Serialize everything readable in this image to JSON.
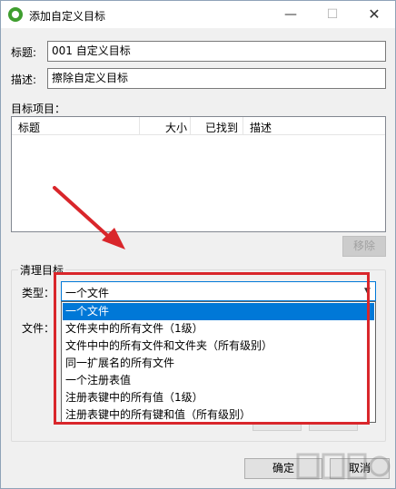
{
  "window": {
    "title": "添加自定义目标",
    "minimize": "—",
    "maximize": "☐",
    "close": "✕"
  },
  "form": {
    "title_label": "标题:",
    "title_value": "001 自定义目标",
    "desc_label": "描述:",
    "desc_value": "擦除自定义目标",
    "items_label": "目标项目："
  },
  "listview": {
    "columns": [
      "标题",
      "大小",
      "已找到",
      "描述"
    ]
  },
  "buttons": {
    "remove": "移除",
    "ok": "确定",
    "cancel": "取消"
  },
  "group": {
    "title": "清理目标",
    "type_label": "类型：",
    "type_selected": "一个文件",
    "file_label": "文件：",
    "options": [
      "一个文件",
      "文件夹中的所有文件（1级）",
      "文件中中的所有文件和文件夹（所有级别）",
      "同一扩展名的所有文件",
      "一个注册表值",
      "注册表键中的所有值（1级）",
      "注册表键中的所有键和值（所有级别）"
    ],
    "selected_index": 0
  },
  "colors": {
    "accent": "#0078d7",
    "annotation": "#d9262b",
    "app_icon": "#3f9e2f"
  },
  "icons": {
    "app": "app-logo-icon",
    "arrow": "red-arrow-icon",
    "dropdown": "chevron-down-icon"
  }
}
